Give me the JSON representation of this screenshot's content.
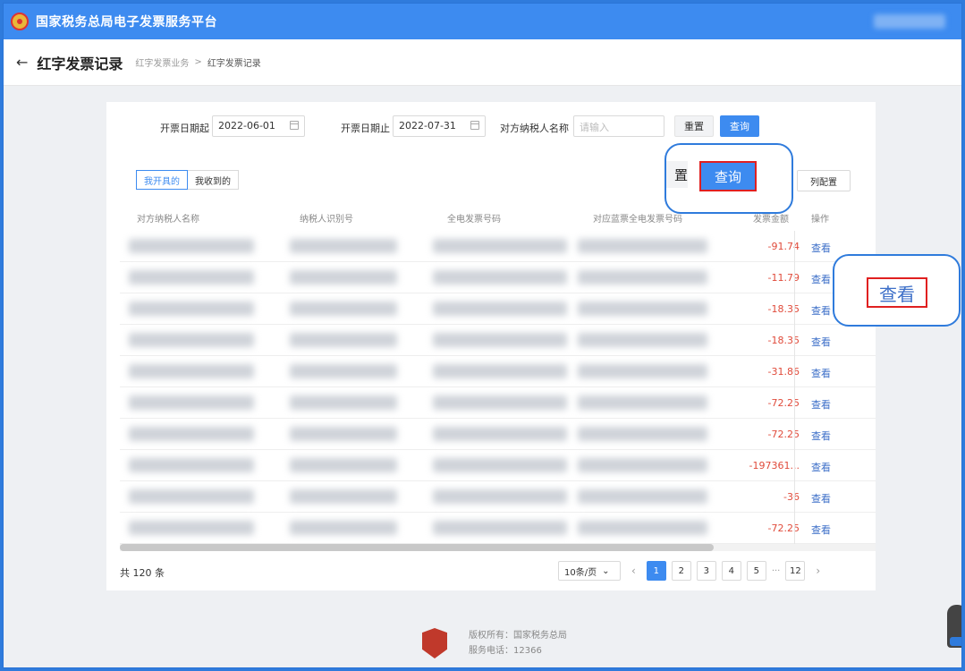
{
  "topbar": {
    "title": "国家税务总局电子发票服务平台"
  },
  "header": {
    "back_icon": "←",
    "title": "红字发票记录",
    "breadcrumb": [
      "红字发票业务",
      "红字发票记录"
    ],
    "breadcrumb_separator": ">"
  },
  "filters": {
    "start_label": "开票日期起",
    "start_value": "2022-06-01",
    "end_label": "开票日期止",
    "end_value": "2022-07-31",
    "party_label": "对方纳税人名称",
    "party_placeholder": "请输入",
    "reset_label": "重置",
    "query_label": "查询"
  },
  "tabs": [
    {
      "label": "我开具的",
      "active": true
    },
    {
      "label": "我收到的",
      "active": false
    }
  ],
  "column_config_label": "列配置",
  "table": {
    "headers": [
      "对方纳税人名称",
      "纳税人识别号",
      "全电发票号码",
      "对应蓝票全电发票号码",
      "发票金额",
      "操作"
    ],
    "amounts": [
      "-91.74",
      "-11.79",
      "-18.35",
      "-18.35",
      "-31.86",
      "-72.25",
      "-72.25",
      "-197361...",
      "-36",
      "-72.25"
    ],
    "action_label": "查看"
  },
  "pagination": {
    "total": "共 120 条",
    "page_size": "10条/页",
    "pages": [
      "1",
      "2",
      "3",
      "4",
      "5"
    ],
    "ellipsis": "···",
    "last_page": "12",
    "current": "1",
    "prev_icon": "‹",
    "next_icon": "›"
  },
  "callouts": {
    "query_fragment": "置",
    "query_label": "查询",
    "view_label": "查看"
  },
  "footer": {
    "copyright": "版权所有：国家税务总局",
    "phone": "服务电话：12366"
  },
  "colors": {
    "primary": "#3d8bf0",
    "negative": "#e04b3b",
    "highlight": "#e02020"
  }
}
